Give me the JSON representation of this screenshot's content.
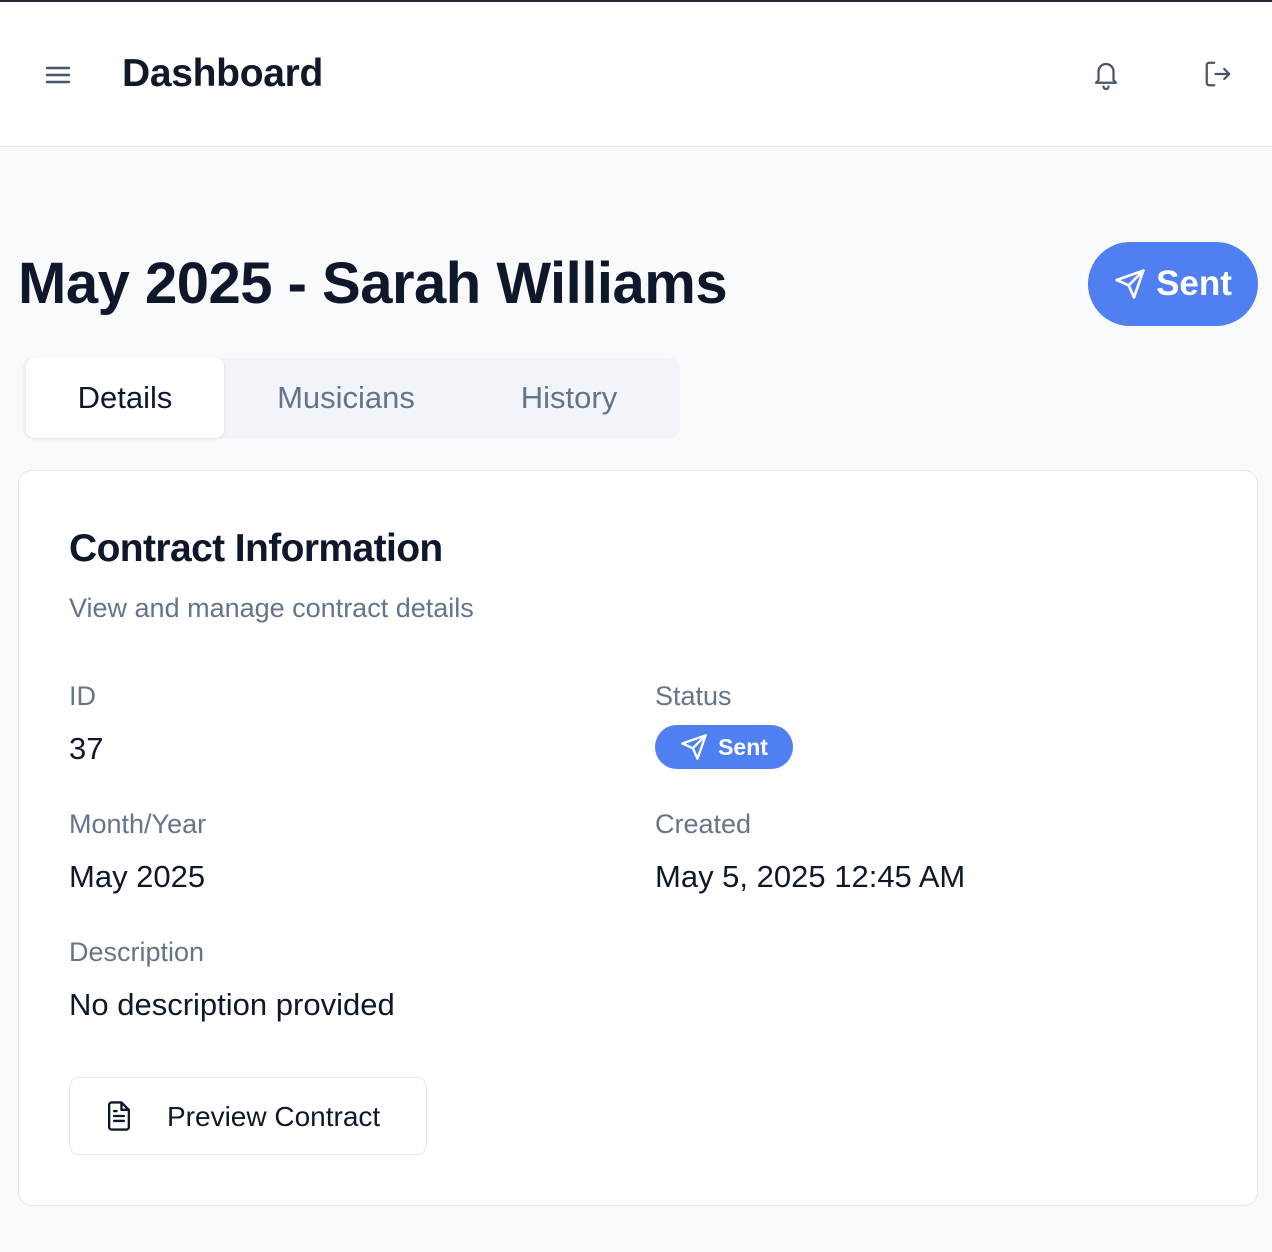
{
  "header": {
    "title": "Dashboard",
    "icons": {
      "menu": "menu-icon",
      "notifications": "bell-icon",
      "logout": "logout-icon"
    }
  },
  "page": {
    "title": "May 2025 - Sarah Williams",
    "status_label": "Sent",
    "status_icon": "send-icon",
    "accent_color": "#4f7ff0"
  },
  "tabs": [
    {
      "label": "Details",
      "active": true
    },
    {
      "label": "Musicians",
      "active": false
    },
    {
      "label": "History",
      "active": false
    }
  ],
  "card": {
    "title": "Contract Information",
    "subtitle": "View and manage contract details",
    "fields": {
      "id": {
        "label": "ID",
        "value": "37"
      },
      "status": {
        "label": "Status",
        "value": "Sent"
      },
      "month_year": {
        "label": "Month/Year",
        "value": "May 2025"
      },
      "created": {
        "label": "Created",
        "value": "May 5, 2025 12:45 AM"
      },
      "description": {
        "label": "Description",
        "value": "No description provided"
      }
    },
    "preview_button": {
      "label": "Preview Contract",
      "icon": "file-text-icon"
    }
  }
}
